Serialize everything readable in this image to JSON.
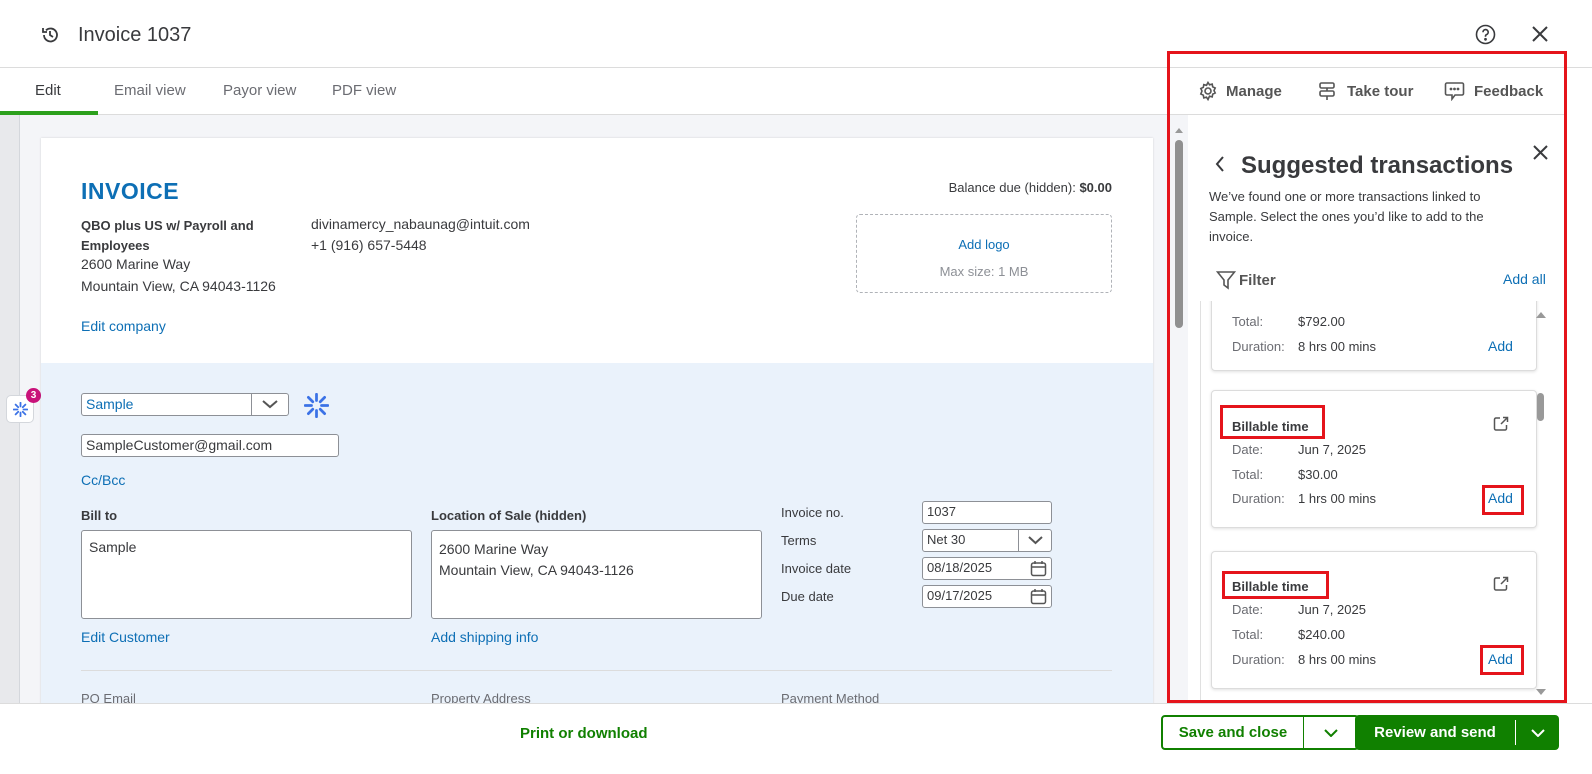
{
  "header": {
    "title": "Invoice 1037",
    "history_icon": "history-icon",
    "help_icon": "help-icon",
    "close_icon": "close-icon"
  },
  "tabs": [
    {
      "label": "Edit"
    },
    {
      "label": "Email view"
    },
    {
      "label": "Payor view"
    },
    {
      "label": "PDF view"
    }
  ],
  "toolbar": {
    "manage": "Manage",
    "take_tour": "Take tour",
    "feedback": "Feedback"
  },
  "invoice": {
    "heading": "INVOICE",
    "company_name": "QBO plus US w/ Payroll and Employees",
    "address1": "2600 Marine Way",
    "address2": "Mountain View, CA 94043-1126",
    "email": "divinamercy_nabaunag@intuit.com",
    "phone": "+1 (916) 657-5448",
    "edit_company": "Edit company",
    "balance_label": "Balance due (hidden):",
    "balance_value": "$0.00",
    "add_logo": "Add logo",
    "max_size": "Max size: 1 MB",
    "customer": "Sample",
    "customer_email": "SampleCustomer@gmail.com",
    "cc_bcc": "Cc/Bcc",
    "bill_to_label": "Bill to",
    "bill_to_value": "Sample",
    "edit_customer": "Edit Customer",
    "location_label": "Location of Sale (hidden)",
    "location_value1": "2600 Marine Way",
    "location_value2": "Mountain View, CA 94043-1126",
    "add_shipping": "Add shipping info",
    "invoice_no_label": "Invoice no.",
    "invoice_no": "1037",
    "terms_label": "Terms",
    "terms": "Net 30",
    "invoice_date_label": "Invoice date",
    "invoice_date": "08/18/2025",
    "due_date_label": "Due date",
    "due_date": "09/17/2025",
    "po_email": "PO Email",
    "property_address": "Property Address",
    "payment_method": "Payment Method",
    "badge_count": "3"
  },
  "panel": {
    "title": "Suggested transactions",
    "description": "We’ve found one or more transactions linked to Sample. Select the ones you’d like to add to the invoice.",
    "filter": "Filter",
    "add_all": "Add all",
    "labels": {
      "date": "Date:",
      "total": "Total:",
      "duration": "Duration:",
      "add": "Add"
    },
    "cards": [
      {
        "title": "",
        "date": "",
        "total": "$792.00",
        "duration": "8 hrs 00 mins"
      },
      {
        "title": "Billable time",
        "date": "Jun 7, 2025",
        "total": "$30.00",
        "duration": "1 hrs 00 mins"
      },
      {
        "title": "Billable time",
        "date": "Jun 7, 2025",
        "total": "$240.00",
        "duration": "8 hrs 00 mins"
      }
    ]
  },
  "footer": {
    "print": "Print or download",
    "save_close": "Save and close",
    "review_send": "Review and send"
  },
  "colors": {
    "green": "#2ca01c",
    "button_green": "#108000",
    "link": "#0d6fb5",
    "annotation": "#e5141b"
  }
}
